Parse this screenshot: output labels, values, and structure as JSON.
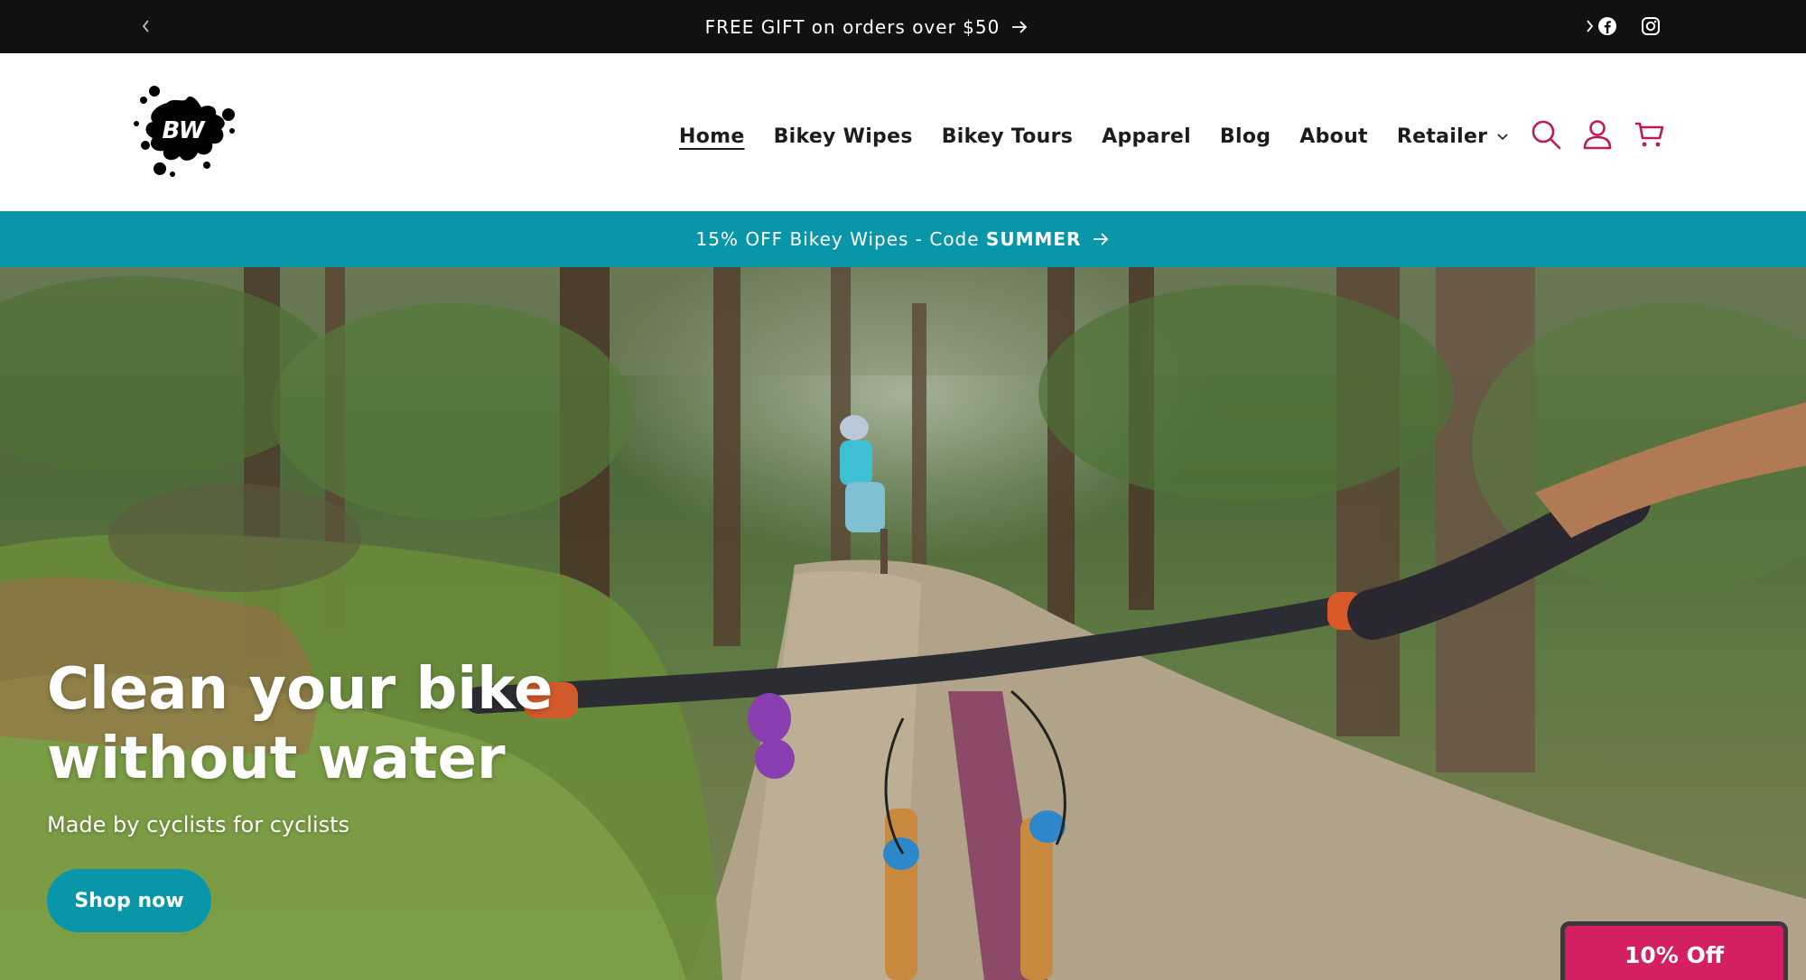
{
  "announcement": {
    "message": "FREE GIFT on orders over $50",
    "prev_icon": "chevron-left-icon",
    "next_icon": "chevron-right-icon",
    "arrow_icon": "arrow-right-icon"
  },
  "social": [
    {
      "name": "facebook-icon"
    },
    {
      "name": "instagram-icon"
    }
  ],
  "header": {
    "logo_text": "BW",
    "nav": [
      {
        "label": "Home",
        "active": true
      },
      {
        "label": "Bikey Wipes"
      },
      {
        "label": "Bikey Tours"
      },
      {
        "label": "Apparel"
      },
      {
        "label": "Blog"
      },
      {
        "label": "About"
      },
      {
        "label": "Retailer",
        "has_dropdown": true
      }
    ],
    "icons": [
      "search-icon",
      "account-icon",
      "cart-icon"
    ]
  },
  "promo": {
    "text_prefix": "15% OFF Bikey Wipes - Code ",
    "code": "SUMMER"
  },
  "hero": {
    "title": "Clean your bike without water",
    "subtitle": "Made by cyclists for cyclists",
    "cta_label": "Shop now"
  },
  "discount_tab": {
    "label": "10% Off"
  },
  "colors": {
    "announcement_bg": "#111111",
    "promo_bg": "#0a96a9",
    "accent_pink": "#c2185b",
    "cta_bg": "#0a96a9",
    "discount_bg": "#d41f63"
  }
}
